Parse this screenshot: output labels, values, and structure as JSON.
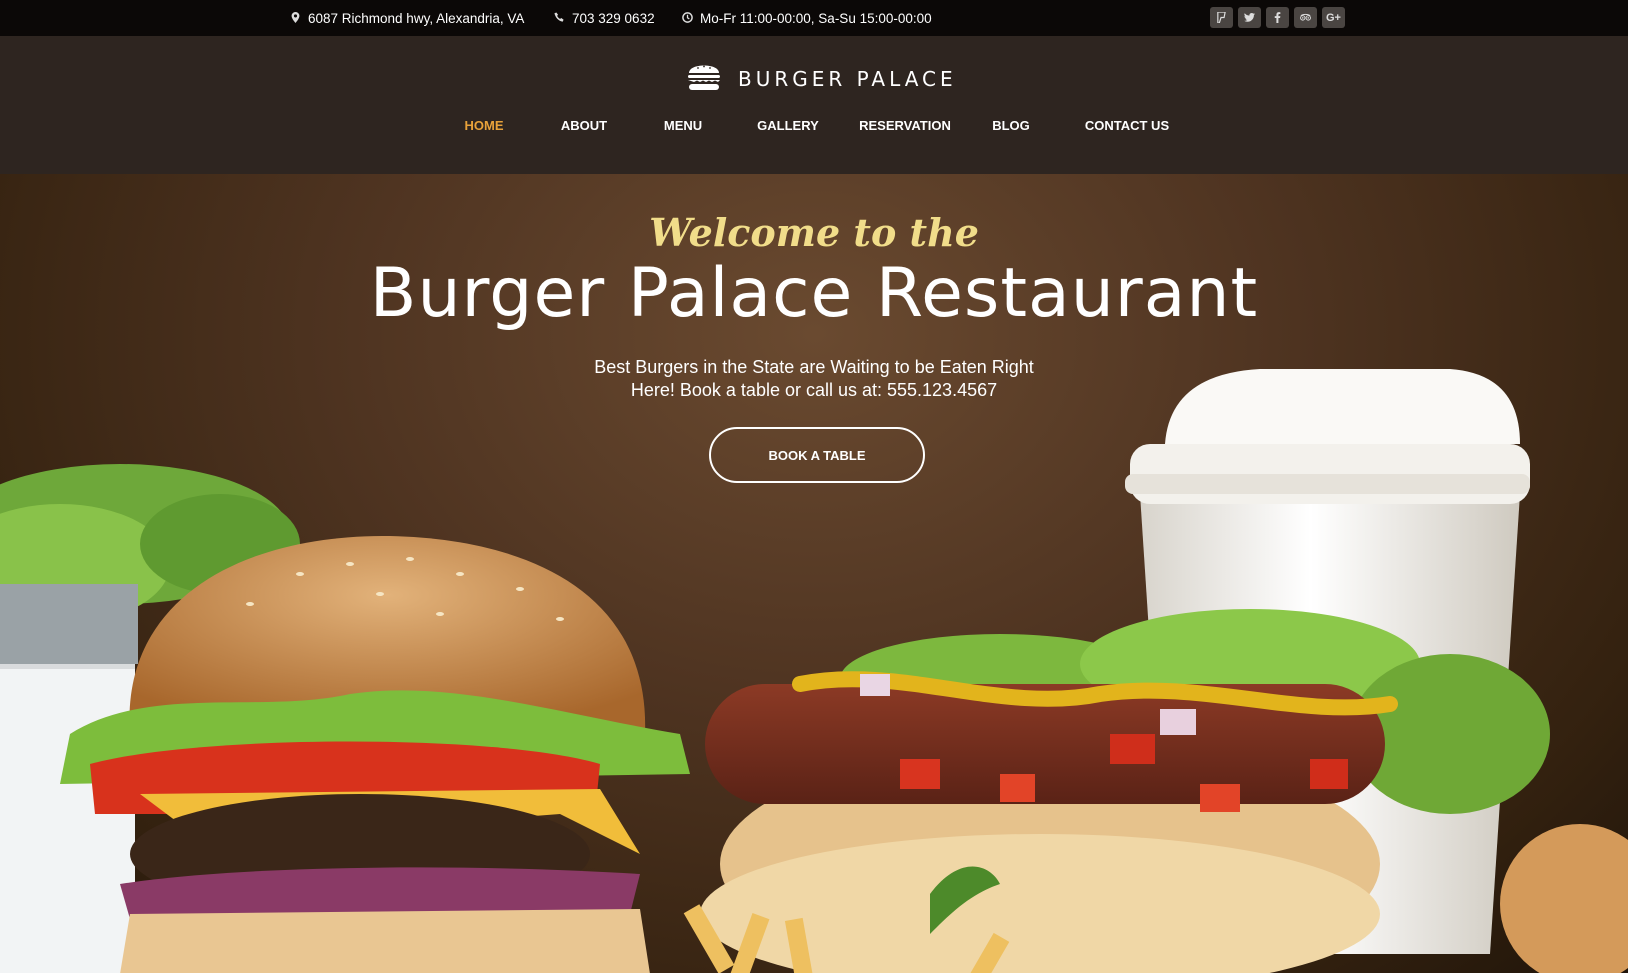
{
  "topbar": {
    "address": "6087 Richmond hwy, Alexandria, VA",
    "phone": "703 329 0632",
    "hours": "Mo-Fr 11:00-00:00, Sa-Su 15:00-00:00",
    "social": [
      "foursquare-icon",
      "twitter-icon",
      "facebook-icon",
      "tripadvisor-icon",
      "google-plus-icon"
    ],
    "social_labels": {
      "google_plus": "G+"
    }
  },
  "header": {
    "brand": "BURGER PALACE",
    "nav": [
      {
        "label": "HOME",
        "active": true
      },
      {
        "label": "ABOUT"
      },
      {
        "label": "MENU"
      },
      {
        "label": "GALLERY"
      },
      {
        "label": "RESERVATION"
      },
      {
        "label": "BLOG"
      },
      {
        "label": "CONTACT US"
      }
    ]
  },
  "hero": {
    "welcome": "Welcome to the",
    "title": "Burger Palace Restaurant",
    "subtitle_line1": "Best Burgers in the State are Waiting to be Eaten Right",
    "subtitle_line2": "Here! Book a table or call us at: 555.123.4567",
    "button": "BOOK A TABLE"
  },
  "colors": {
    "accent": "#e8a23a",
    "topbar_bg": "#0b0807",
    "header_bg": "#2e2520",
    "welcome_text": "#f1dd8a"
  }
}
